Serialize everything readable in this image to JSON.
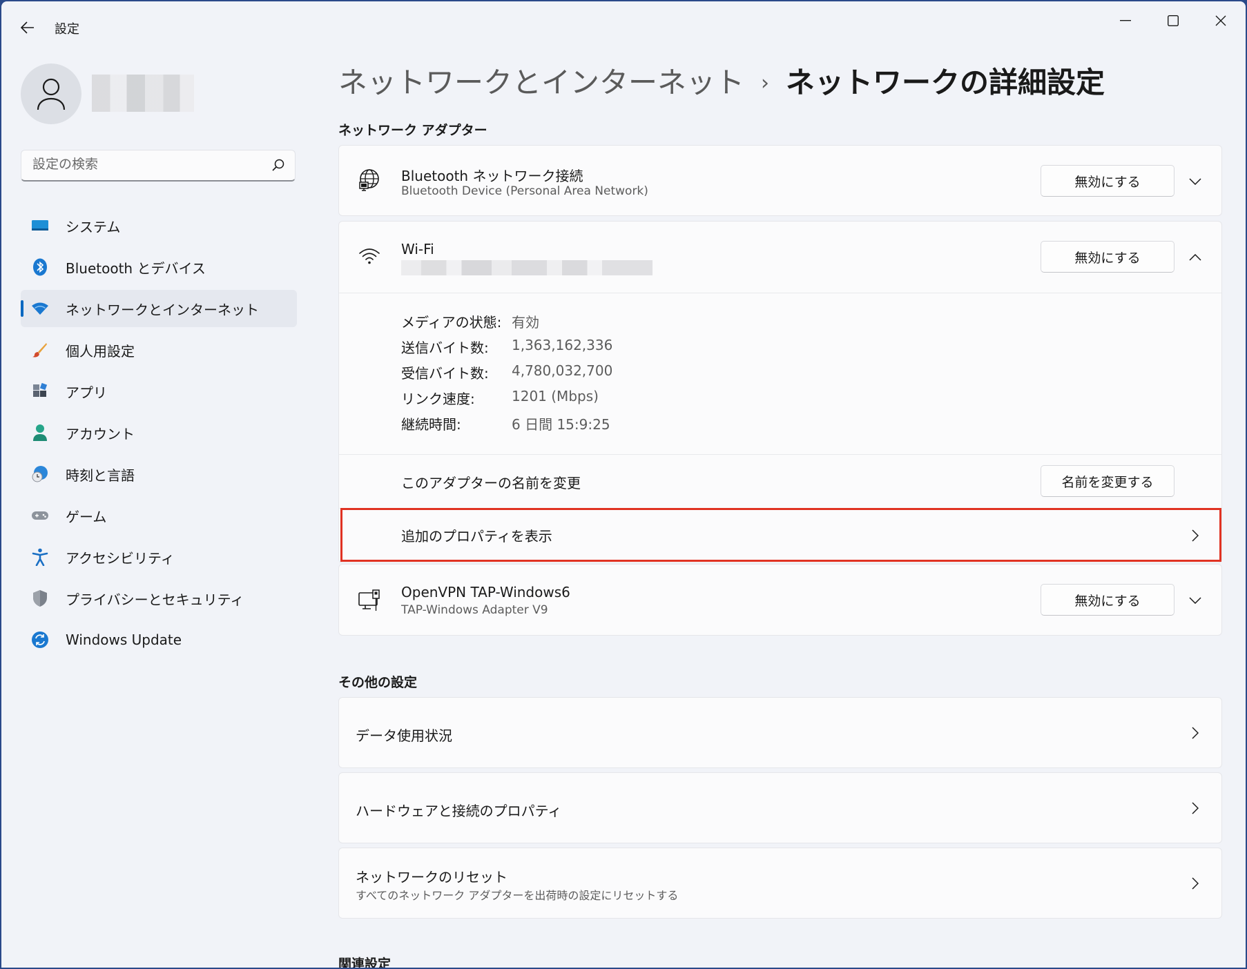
{
  "window": {
    "app_title": "設定"
  },
  "sidebar": {
    "search_placeholder": "設定の検索",
    "items": [
      {
        "label": "システム",
        "icon": "system-display-icon",
        "active": false
      },
      {
        "label": "Bluetooth とデバイス",
        "icon": "bluetooth-icon",
        "active": false
      },
      {
        "label": "ネットワークとインターネット",
        "icon": "wifi-icon",
        "active": true
      },
      {
        "label": "個人用設定",
        "icon": "paintbrush-icon",
        "active": false
      },
      {
        "label": "アプリ",
        "icon": "apps-icon",
        "active": false
      },
      {
        "label": "アカウント",
        "icon": "person-icon",
        "active": false
      },
      {
        "label": "時刻と言語",
        "icon": "globe-clock-icon",
        "active": false
      },
      {
        "label": "ゲーム",
        "icon": "gamepad-icon",
        "active": false
      },
      {
        "label": "アクセシビリティ",
        "icon": "accessibility-icon",
        "active": false
      },
      {
        "label": "プライバシーとセキュリティ",
        "icon": "shield-icon",
        "active": false
      },
      {
        "label": "Windows Update",
        "icon": "update-sync-icon",
        "active": false
      }
    ]
  },
  "breadcrumb": {
    "parent": "ネットワークとインターネット",
    "separator": "›",
    "current": "ネットワークの詳細設定"
  },
  "adapters_section": {
    "title": "ネットワーク アダプター",
    "bluetooth": {
      "title": "Bluetooth ネットワーク接続",
      "subtitle": "Bluetooth Device (Personal Area Network)",
      "button": "無効にする"
    },
    "wifi": {
      "title": "Wi-Fi",
      "button": "無効にする",
      "properties": [
        {
          "label": "メディアの状態:",
          "value": "有効"
        },
        {
          "label": "送信バイト数:",
          "value": "1,363,162,336"
        },
        {
          "label": "受信バイト数:",
          "value": "4,780,032,700"
        },
        {
          "label": "リンク速度:",
          "value": "1201 (Mbps)"
        },
        {
          "label": "継続時間:",
          "value": "6 日間 15:9:25"
        }
      ],
      "rename_label": "このアダプターの名前を変更",
      "rename_button": "名前を変更する",
      "more_props_label": "追加のプロパティを表示"
    },
    "openvpn": {
      "title": "OpenVPN TAP-Windows6",
      "subtitle": "TAP-Windows Adapter V9",
      "button": "無効にする"
    }
  },
  "other_section": {
    "title": "その他の設定",
    "items": [
      {
        "title": "データ使用状況"
      },
      {
        "title": "ハードウェアと接続のプロパティ"
      },
      {
        "title": "ネットワークのリセット",
        "subtitle": "すべてのネットワーク アダプターを出荷時の設定にリセットする"
      }
    ]
  },
  "related_section": {
    "title": "関連設定"
  },
  "colors": {
    "accent": "#0067c0",
    "highlight_border": "#e03222"
  }
}
